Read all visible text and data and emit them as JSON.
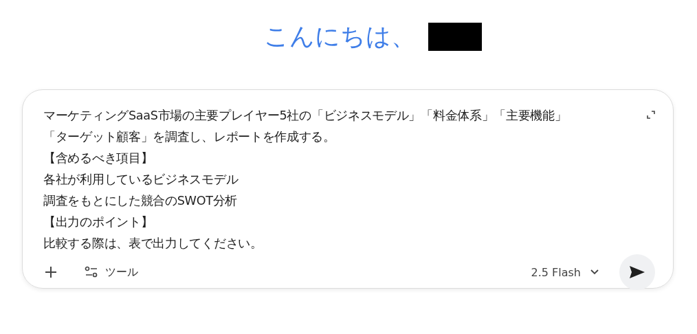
{
  "greeting": {
    "text": "こんにちは、"
  },
  "prompt": {
    "lines": [
      "マーケティングSaaS市場の主要プレイヤー5社の「ビジネスモデル」「料金体系」「主要機能」",
      "「ターゲット顧客」を調査し、レポートを作成する。",
      "【含めるべき項目】",
      "各社が利用しているビジネスモデル",
      "調査をもとにした競合のSWOT分析",
      "【出力のポイント】",
      "比較する際は、表で出力してください。"
    ]
  },
  "toolbar": {
    "tools_label": "ツール",
    "model": "2.5 Flash"
  }
}
